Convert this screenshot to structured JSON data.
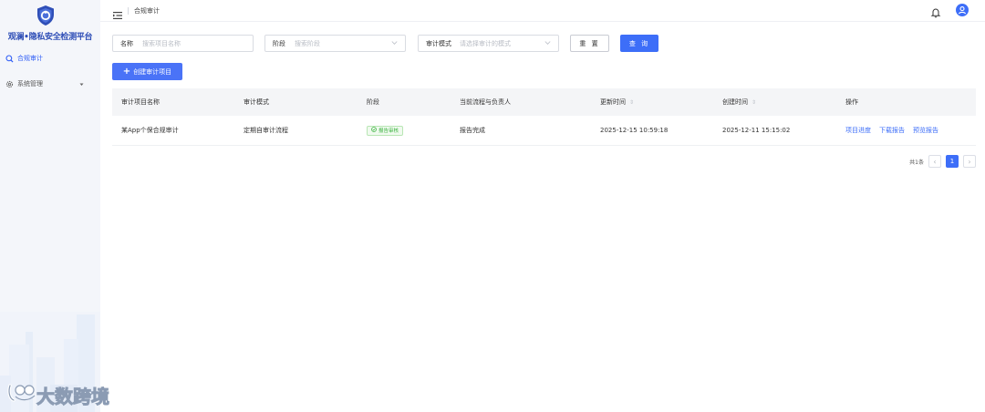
{
  "app": {
    "brand_name": "观澜•隐私安全检测平台"
  },
  "sidebar": {
    "items": [
      {
        "label": "合规审计",
        "icon": "audit-icon",
        "active": true
      },
      {
        "label": "系统管理",
        "icon": "gear-icon",
        "active": false
      }
    ]
  },
  "header": {
    "breadcrumb": "合规审计"
  },
  "filters": {
    "name": {
      "label": "名称",
      "placeholder": "搜索项目名称"
    },
    "stage": {
      "label": "阶段",
      "placeholder": "搜索阶段"
    },
    "mode": {
      "label": "审计模式",
      "placeholder": "请选择审计的模式"
    },
    "reset_label": "重 置",
    "search_label": "查 询"
  },
  "toolbar": {
    "create_label": "创建审计项目"
  },
  "table": {
    "columns": [
      "审计项目名称",
      "审计模式",
      "阶段",
      "当前流程与负责人",
      "更新时间",
      "创建时间",
      "操作"
    ],
    "rows": [
      {
        "name": "某App个保合规审计",
        "mode": "定期自审计流程",
        "stage": "报告审核",
        "flow": "报告完成",
        "updated": "2025-12-15 10:59:18",
        "created": "2025-12-11 15:15:02",
        "actions": [
          "项目进度",
          "下载报告",
          "预览报告"
        ]
      }
    ]
  },
  "pagination": {
    "total_label": "共1条",
    "current_page": "1"
  },
  "watermark": {
    "text": "大数跨境"
  },
  "colors": {
    "accent": "#3d6ef8",
    "brand": "#2f4fb7",
    "success": "#3cb33f",
    "sidebar_bg": "#f4f6fa"
  }
}
